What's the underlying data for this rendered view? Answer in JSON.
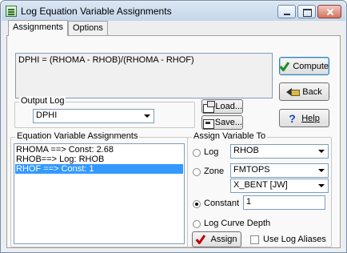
{
  "window": {
    "title": "Log Equation Variable Assignments"
  },
  "tabs": [
    {
      "label": "Assignments"
    },
    {
      "label": "Options"
    }
  ],
  "equation": {
    "text": "DPHI = (RHOMA - RHOB)/(RHOMA - RHOF)"
  },
  "buttons": {
    "compute": "Compute",
    "back": "Back",
    "help": "Help",
    "load": "Load...",
    "save": "Save...",
    "assign": "Assign"
  },
  "output_log": {
    "label": "Output Log",
    "value": "DPHI"
  },
  "assignments": {
    "label": "Equation Variable Assignments",
    "items": [
      {
        "text": "RHOMA ==> Const: 2.68"
      },
      {
        "text": "RHOB==> Log: RHOB"
      },
      {
        "text": "RHOF ==> Const: 1"
      }
    ],
    "selected_index": 2
  },
  "assign_to": {
    "label": "Assign Variable To",
    "log_label": "Log",
    "log_value": "RHOB",
    "zone_label": "Zone",
    "zone_value": "FMTOPS",
    "zone_sub_value": "X_BENT  [JW]",
    "constant_label": "Constant",
    "constant_value": "1",
    "curve_depth_label": "Log Curve Depth",
    "selected": "constant",
    "use_aliases_label": "Use Log Aliases",
    "use_aliases_checked": false
  },
  "colors": {
    "selection": "#3399ff",
    "check_green": "#1f8a1f",
    "check_red": "#c00000",
    "help_blue": "#1a3fbf"
  }
}
